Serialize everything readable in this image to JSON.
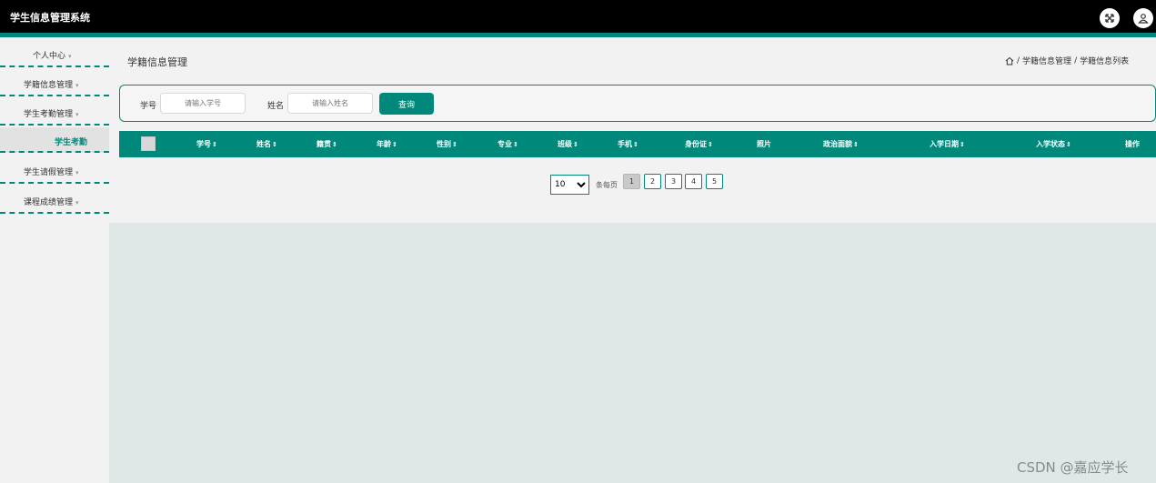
{
  "header": {
    "app_title": "学生信息管理系统",
    "icons": [
      "fullscreen-icon",
      "user-icon"
    ]
  },
  "sidebar": {
    "items": [
      {
        "label": "个人中心",
        "caret": "▾"
      },
      {
        "label": "学籍信息管理",
        "caret": "▾"
      },
      {
        "label": "学生考勤管理",
        "caret": "▾"
      },
      {
        "label": "学生考勤"
      },
      {
        "label": "学生请假管理",
        "caret": "▾"
      },
      {
        "label": "课程成绩管理",
        "caret": "▾"
      }
    ]
  },
  "page": {
    "title": "学籍信息管理",
    "breadcrumb": [
      "学籍信息管理",
      "学籍信息列表"
    ],
    "breadcrumb_sep": "/"
  },
  "search": {
    "student_id_label": "学号",
    "student_id_placeholder": "请输入学号",
    "name_label": "姓名",
    "name_placeholder": "请输入姓名",
    "button_label": "查询"
  },
  "table": {
    "sort_glyph": "⇕",
    "columns": [
      {
        "label": "学号",
        "sortable": true
      },
      {
        "label": "姓名",
        "sortable": true
      },
      {
        "label": "籍贯",
        "sortable": true
      },
      {
        "label": "年龄",
        "sortable": true
      },
      {
        "label": "性别",
        "sortable": true
      },
      {
        "label": "专业",
        "sortable": true
      },
      {
        "label": "班级",
        "sortable": true
      },
      {
        "label": "手机",
        "sortable": true
      },
      {
        "label": "身份证",
        "sortable": true
      },
      {
        "label": "照片",
        "sortable": false
      },
      {
        "label": "政治面貌",
        "sortable": true
      },
      {
        "label": "入学日期",
        "sortable": true
      },
      {
        "label": "入学状态",
        "sortable": true
      },
      {
        "label": "操作",
        "sortable": false
      }
    ]
  },
  "pagination": {
    "page_size": "10",
    "per_page_label": "条每页",
    "pages": [
      "1",
      "2",
      "3",
      "4",
      "5"
    ],
    "current_page": "1"
  },
  "watermark": "CSDN @嘉应学长",
  "colors": {
    "accent": "#00897b",
    "topbar": "#000000",
    "content_bg": "#dfe8e6"
  }
}
